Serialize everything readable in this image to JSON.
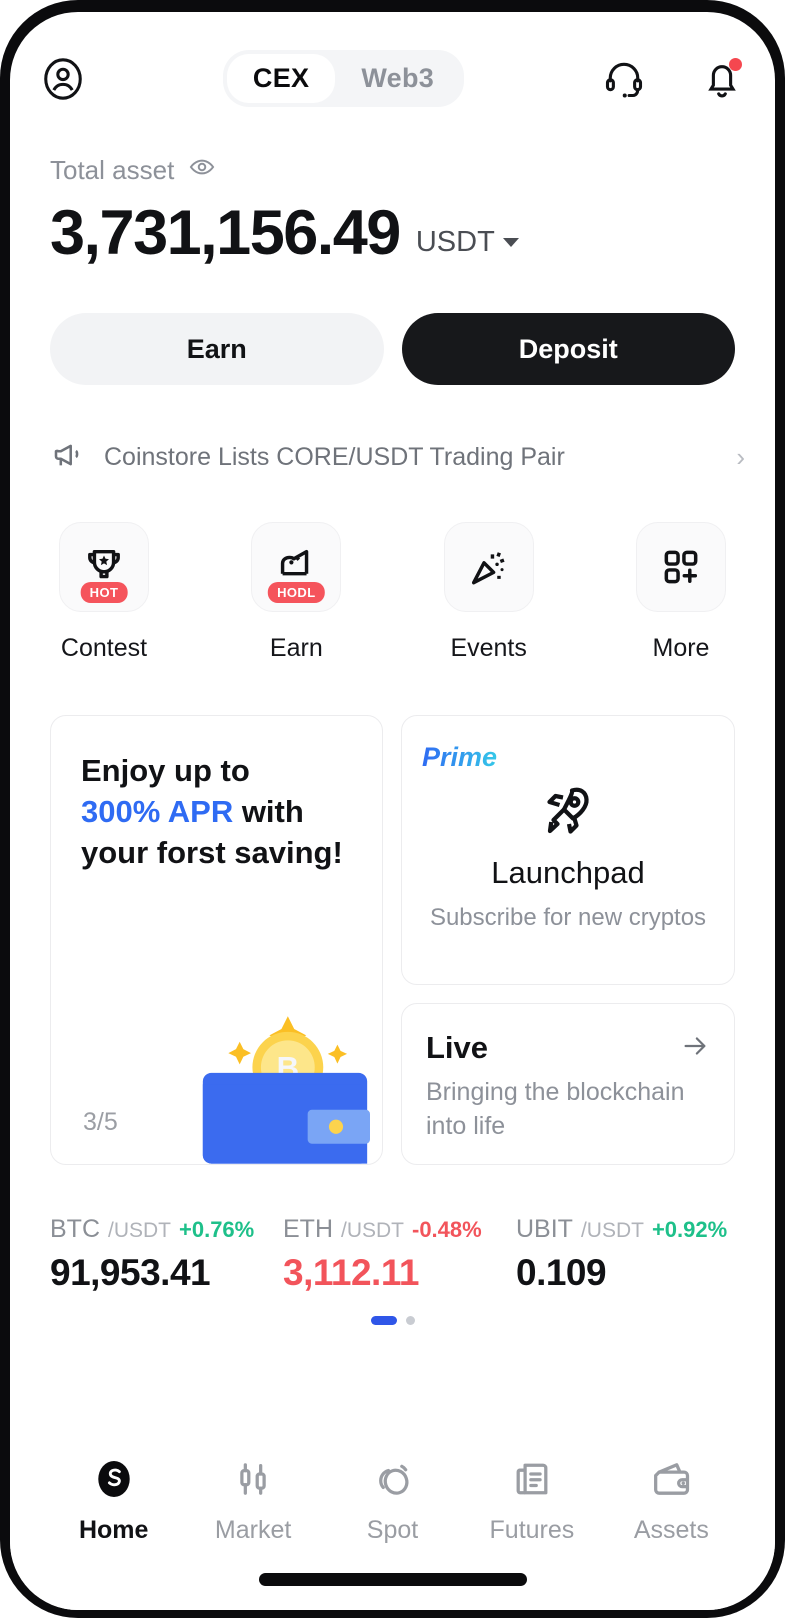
{
  "header": {
    "profile_icon": "user-circle-icon",
    "segments": [
      {
        "label": "CEX",
        "active": true
      },
      {
        "label": "Web3",
        "active": false
      }
    ],
    "support_icon": "headset-icon",
    "notification_icon": "bell-icon",
    "notification_badge": true
  },
  "asset": {
    "label": "Total asset",
    "eye_icon": "eye-icon",
    "value": "3,731,156.49",
    "currency": "USDT"
  },
  "actions": {
    "earn_label": "Earn",
    "deposit_label": "Deposit"
  },
  "announcement": {
    "icon": "megaphone-icon",
    "text": "Coinstore Lists CORE/USDT Trading Pair",
    "chevron": "›"
  },
  "quick_actions": [
    {
      "label": "Contest",
      "icon": "trophy-icon",
      "badge": "HOT"
    },
    {
      "label": "Earn",
      "icon": "piggy-bank-icon",
      "badge": "HODL"
    },
    {
      "label": "Events",
      "icon": "confetti-icon",
      "badge": ""
    },
    {
      "label": "More",
      "icon": "grid-plus-icon",
      "badge": ""
    }
  ],
  "promo_card": {
    "line1": "Enjoy up to",
    "highlight": "300% APR",
    "line2_rest": " with",
    "line3": "your forst saving!",
    "counter_current": "3",
    "counter_total": "/5",
    "art_icon": "wallet-bitcoin-icon"
  },
  "launchpad_card": {
    "tag": "Prime",
    "icon": "rocket-icon",
    "title": "Launchpad",
    "subtitle": "Subscribe for new cryptos"
  },
  "live_card": {
    "title": "Live",
    "arrow_icon": "arrow-right-icon",
    "subtitle": "Bringing the blockchain into life"
  },
  "tickers": [
    {
      "base": "BTC",
      "quote": "/USDT",
      "change": "+0.76%",
      "direction": "up",
      "price": "91,953.41",
      "price_negative": false
    },
    {
      "base": "ETH",
      "quote": "/USDT",
      "change": "-0.48%",
      "direction": "down",
      "price": "3,112.11",
      "price_negative": true
    },
    {
      "base": "UBIT",
      "quote": "/USDT",
      "change": "+0.92%",
      "direction": "up",
      "price": "0.109",
      "price_negative": false
    }
  ],
  "pagination": {
    "active_index": 0,
    "total": 2
  },
  "nav": [
    {
      "label": "Home",
      "icon": "coinstore-logo-icon",
      "active": true
    },
    {
      "label": "Market",
      "icon": "candlestick-icon",
      "active": false
    },
    {
      "label": "Spot",
      "icon": "spot-trade-icon",
      "active": false
    },
    {
      "label": "Futures",
      "icon": "futures-doc-icon",
      "active": false
    },
    {
      "label": "Assets",
      "icon": "wallet-icon",
      "active": false
    }
  ],
  "colors": {
    "accent_blue": "#2f6bf3",
    "up_green": "#1ec08a",
    "down_red": "#f2545b",
    "badge_red": "#f5545c",
    "dark": "#17181b"
  }
}
